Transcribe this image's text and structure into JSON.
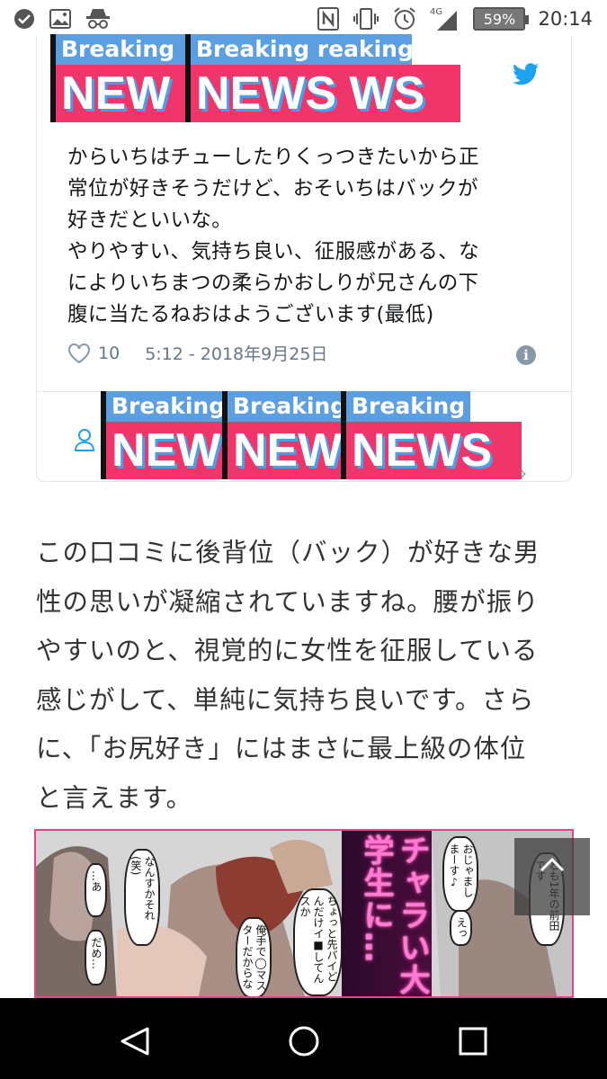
{
  "status_bar": {
    "time": "20:14",
    "battery_percent": "59%",
    "network": "4G",
    "icons": [
      "check-circle-icon",
      "image-icon",
      "incognito-icon",
      "nfc-icon",
      "vibrate-icon",
      "alarm-icon",
      "signal-icon",
      "battery-icon"
    ]
  },
  "tweet": {
    "text_lines": [
      "からいちはチューしたりくっつきたいから正",
      "常位が好きそうだけど、おそいちはバックが",
      "好きだといいな。",
      "やりやすい、気持ち良い、征服感がある、な",
      "によりいちまつの柔らかおしりが兄さんの下",
      "腹に当たるねおはようございます(最低)"
    ],
    "likes": "10",
    "timestamp": "5:12 - 2018年9月25日"
  },
  "stickers": [
    {
      "top": "Breaking",
      "bottom": "NEW"
    },
    {
      "top": "Breaking reaking",
      "bottom": "NEWS WS"
    },
    {
      "top": "Breaking",
      "bottom": "NEW"
    },
    {
      "top": "Breaking",
      "bottom": "NEW"
    },
    {
      "top": "Breaking",
      "bottom": "NEWS"
    }
  ],
  "article": {
    "lines": [
      "この口コミに後背位（バック）が好きな男",
      "性の思いが凝縮されていますね。腰が振り",
      "やすいのと、視覚的に女性を征服している",
      "感じがして、単純に気持ち良いです。さら",
      "に、「お尻好き」にはまさに最上級の体位",
      "と言えます。"
    ]
  },
  "manga_ad": {
    "title": "チャラい大学生に…",
    "bubbles": [
      "…あ",
      "なんすかそれ(笑)",
      "だめ…",
      "俺手で◯マスターだからな",
      "ちょっと先パイどんだけイ■してんスか",
      "おじゃましまーす♪",
      "えっ",
      "ども1年の前田です"
    ]
  },
  "nav": {
    "buttons": [
      "back-icon",
      "home-icon",
      "recents-icon"
    ]
  }
}
